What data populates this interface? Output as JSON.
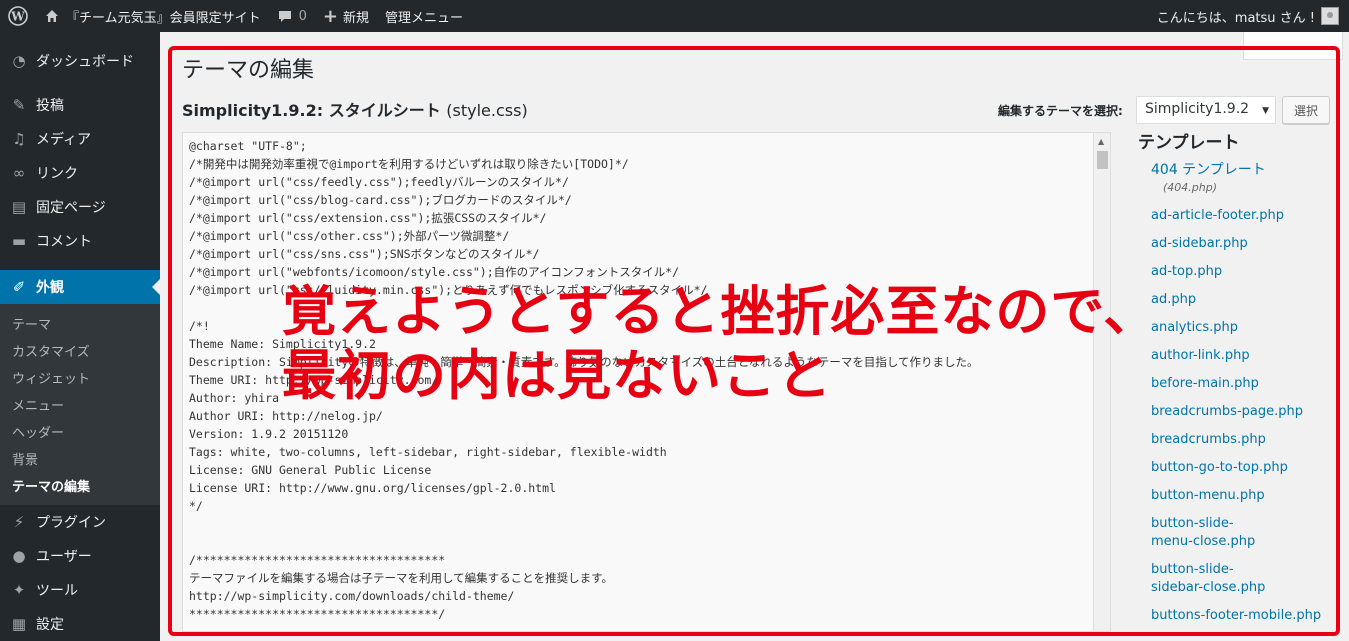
{
  "admin_bar": {
    "wp_logo_icon": "wordpress-logo-icon",
    "site_name": "『チーム元気玉』会員限定サイト",
    "comments_count": "0",
    "new_label": "新規",
    "admin_menu_label": "管理メニュー",
    "greeting": "こんにちは、matsu さん !"
  },
  "sidebar": {
    "items": [
      {
        "label": "ダッシュボード",
        "icon": "dashboard-icon"
      },
      {
        "label": "投稿",
        "icon": "pin-icon"
      },
      {
        "label": "メディア",
        "icon": "media-icon"
      },
      {
        "label": "リンク",
        "icon": "link-icon"
      },
      {
        "label": "固定ページ",
        "icon": "page-icon"
      },
      {
        "label": "コメント",
        "icon": "comment-icon"
      },
      {
        "label": "外観",
        "icon": "brush-icon"
      }
    ],
    "submenu": [
      "テーマ",
      "カスタマイズ",
      "ウィジェット",
      "メニュー",
      "ヘッダー",
      "背景",
      "テーマの編集"
    ],
    "items_after": [
      {
        "label": "プラグイン",
        "icon": "plugin-icon"
      },
      {
        "label": "ユーザー",
        "icon": "user-icon"
      },
      {
        "label": "ツール",
        "icon": "wrench-icon"
      },
      {
        "label": "設定",
        "icon": "settings-icon"
      }
    ]
  },
  "page": {
    "title": "テーマの編集",
    "file_heading_theme": "Simplicity1.9.2:",
    "file_heading_file": "スタイルシート",
    "file_heading_name": "(style.css)",
    "select_theme_label": "編集するテーマを選択:",
    "selected_theme": "Simplicity1.9.2",
    "select_button": "選択"
  },
  "editor": {
    "content": "@charset \"UTF-8\";\n/*開発中は開発効率重視で@importを利用するけどいずれは取り除きたい[TODO]*/\n/*@import url(\"css/feedly.css\");feedlyバルーンのスタイル*/\n/*@import url(\"css/blog-card.css\");ブログカードのスタイル*/\n/*@import url(\"css/extension.css\");拡張CSSのスタイル*/\n/*@import url(\"css/other.css\");外部パーツ微調整*/\n/*@import url(\"css/sns.css\");SNSボタンなどのスタイル*/\n/*@import url(\"webfonts/icomoon/style.css\");自作のアイコンフォントスタイル*/\n/*@import url(\"css/fluidity.min.css\");とりあえず何でもレスポンシブ化するスタイル*/\n\n/*!\nTheme Name: Simplicity1.9.2\nDescription: Simplicityの特徴は、単純・簡単・簡素・質素です。飾り気のないカスタマイズの土台となれるようなテーマを目指して作りました。\nTheme URI: http://wp-simplicity.com/\nAuthor: yhira\nAuthor URI: http://nelog.jp/\nVersion: 1.9.2 20151120\nTags: white, two-columns, left-sidebar, right-sidebar, flexible-width\nLicense: GNU General Public License\nLicense URI: http://www.gnu.org/licenses/gpl-2.0.html\n*/\n\n\n/************************************\nテーマファイルを編集する場合は子テーマを利用して編集することを推奨します。\nhttp://wp-simplicity.com/downloads/child-theme/\n************************************/"
  },
  "templates": {
    "heading": "テンプレート",
    "files": [
      {
        "label": "404 テンプレート",
        "sub": "(404.php)"
      },
      {
        "label": "ad-article-footer.php"
      },
      {
        "label": "ad-sidebar.php"
      },
      {
        "label": "ad-top.php"
      },
      {
        "label": "ad.php"
      },
      {
        "label": "analytics.php"
      },
      {
        "label": "author-link.php"
      },
      {
        "label": "before-main.php"
      },
      {
        "label": "breadcrumbs-page.php"
      },
      {
        "label": "breadcrumbs.php"
      },
      {
        "label": "button-go-to-top.php"
      },
      {
        "label": "button-menu.php"
      },
      {
        "label": "button-slide-menu-close.php"
      },
      {
        "label": "button-slide-sidebar-close.php"
      },
      {
        "label": "buttons-footer-mobile.php"
      }
    ]
  },
  "annotation": {
    "line1": "覚えようとすると挫折必至なので、",
    "line2": "最初の内は見ないこと",
    "color": "#e60012"
  }
}
